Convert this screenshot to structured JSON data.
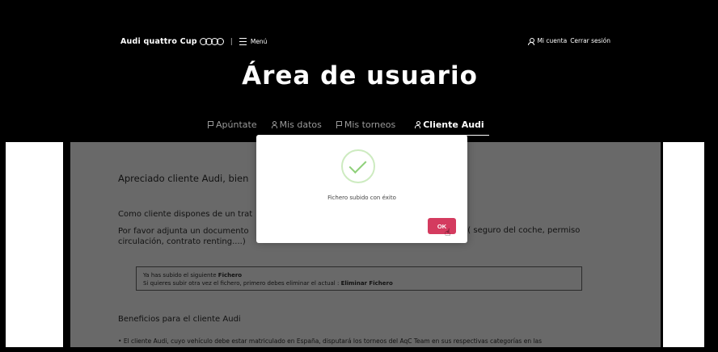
{
  "header": {
    "brand": "Audi quattro Cup",
    "separator": "|",
    "menu_label": "Menú",
    "account_label": "Mi cuenta",
    "logout_label": "Cerrar sesión"
  },
  "page_title": "Área de usuario",
  "tabs": [
    {
      "label": "Apúntate",
      "icon": "flag-icon",
      "active": false
    },
    {
      "label": "Mis datos",
      "icon": "user-icon",
      "active": false
    },
    {
      "label": "Mis torneos",
      "icon": "flag-icon",
      "active": false
    },
    {
      "label": "Cliente Audi",
      "icon": "user-icon",
      "active": true
    }
  ],
  "content": {
    "greeting": "Apreciado cliente Audi, bien",
    "paragraph1": "Como cliente dispones de un trat",
    "paragraph2_left": "Por favor adjunta un documento",
    "paragraph2_right": "o ( seguro del coche, permiso",
    "paragraph2_line2": "circulación, contrato renting....)",
    "info_line1_prefix": "Ya has subido el siguiente",
    "info_line1_bold": "Fichero",
    "info_line2_prefix": "Si quieres subir otra vez el fichero, primero debes eliminar el actual :",
    "info_line2_link": "Eliminar Fichero",
    "benefits_title": "Beneficios para el cliente Audi",
    "bullet1": "El cliente Audi, cuyo vehículo debe estar matriculado en España, disputará los torneos del AqC Team en sus respectivas categorías en las"
  },
  "modal": {
    "message": "Fichero subido con éxito",
    "ok_label": "OK",
    "icon": "check-icon"
  }
}
